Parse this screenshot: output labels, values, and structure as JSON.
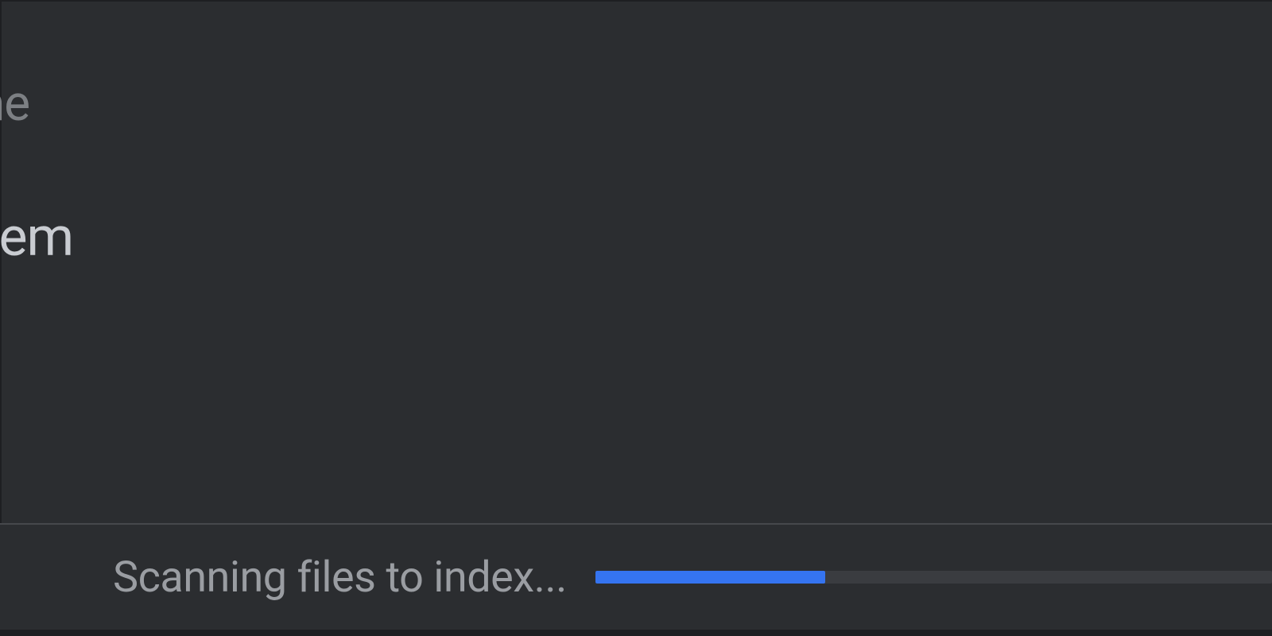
{
  "editor": {
    "partial_line_1": "ne",
    "partial_line_2": "hem"
  },
  "status": {
    "message": "Scanning files to index...",
    "progress_percent": 34,
    "accent_color": "#3574f0",
    "track_color": "#3a3c40"
  }
}
